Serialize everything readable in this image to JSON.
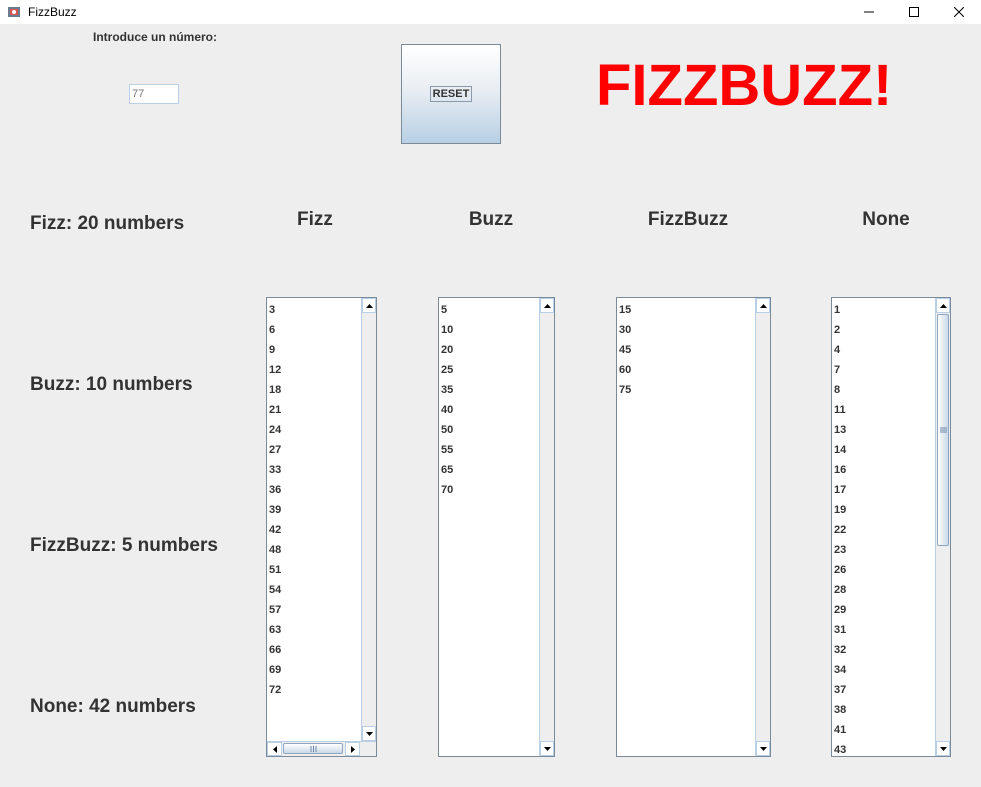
{
  "window": {
    "title": "FizzBuzz"
  },
  "input": {
    "label": "Introduce un número:",
    "placeholder": "77"
  },
  "reset_label": "RESET",
  "title": "FIZZBUZZ!",
  "stats": {
    "fizz": "Fizz: 20 numbers",
    "buzz": "Buzz: 10 numbers",
    "fizzbuzz": "FizzBuzz: 5 numbers",
    "none": "None: 42 numbers"
  },
  "columns": {
    "fizz": {
      "header": "Fizz",
      "items": [
        "3",
        "6",
        "9",
        "12",
        "18",
        "21",
        "24",
        "27",
        "33",
        "36",
        "39",
        "42",
        "48",
        "51",
        "54",
        "57",
        "63",
        "66",
        "69",
        "72"
      ]
    },
    "buzz": {
      "header": "Buzz",
      "items": [
        "5",
        "10",
        "20",
        "25",
        "35",
        "40",
        "50",
        "55",
        "65",
        "70"
      ]
    },
    "fizzbuzz": {
      "header": "FizzBuzz",
      "items": [
        "15",
        "30",
        "45",
        "60",
        "75"
      ]
    },
    "none": {
      "header": "None",
      "items": [
        "1",
        "2",
        "4",
        "7",
        "8",
        "11",
        "13",
        "14",
        "16",
        "17",
        "19",
        "22",
        "23",
        "26",
        "28",
        "29",
        "31",
        "32",
        "34",
        "37",
        "38",
        "41",
        "43"
      ]
    }
  },
  "colors": {
    "title": "#ff0000",
    "text": "#333333",
    "background": "#eeeeee",
    "accent": "#b8cfe5"
  }
}
